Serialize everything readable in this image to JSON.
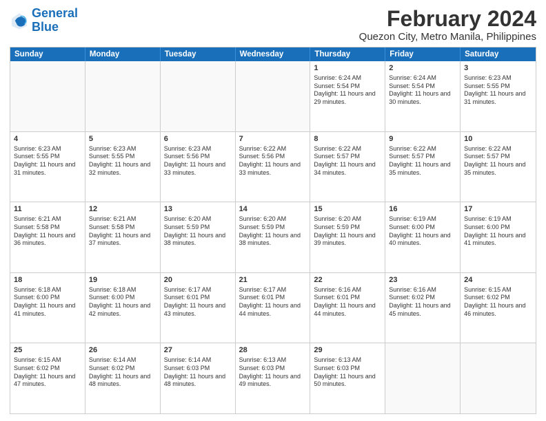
{
  "logo": {
    "line1": "General",
    "line2": "Blue"
  },
  "title": "February 2024",
  "subtitle": "Quezon City, Metro Manila, Philippines",
  "weekdays": [
    "Sunday",
    "Monday",
    "Tuesday",
    "Wednesday",
    "Thursday",
    "Friday",
    "Saturday"
  ],
  "weeks": [
    [
      {
        "day": "",
        "sunrise": "",
        "sunset": "",
        "daylight": ""
      },
      {
        "day": "",
        "sunrise": "",
        "sunset": "",
        "daylight": ""
      },
      {
        "day": "",
        "sunrise": "",
        "sunset": "",
        "daylight": ""
      },
      {
        "day": "",
        "sunrise": "",
        "sunset": "",
        "daylight": ""
      },
      {
        "day": "1",
        "sunrise": "Sunrise: 6:24 AM",
        "sunset": "Sunset: 5:54 PM",
        "daylight": "Daylight: 11 hours and 29 minutes."
      },
      {
        "day": "2",
        "sunrise": "Sunrise: 6:24 AM",
        "sunset": "Sunset: 5:54 PM",
        "daylight": "Daylight: 11 hours and 30 minutes."
      },
      {
        "day": "3",
        "sunrise": "Sunrise: 6:23 AM",
        "sunset": "Sunset: 5:55 PM",
        "daylight": "Daylight: 11 hours and 31 minutes."
      }
    ],
    [
      {
        "day": "4",
        "sunrise": "Sunrise: 6:23 AM",
        "sunset": "Sunset: 5:55 PM",
        "daylight": "Daylight: 11 hours and 31 minutes."
      },
      {
        "day": "5",
        "sunrise": "Sunrise: 6:23 AM",
        "sunset": "Sunset: 5:55 PM",
        "daylight": "Daylight: 11 hours and 32 minutes."
      },
      {
        "day": "6",
        "sunrise": "Sunrise: 6:23 AM",
        "sunset": "Sunset: 5:56 PM",
        "daylight": "Daylight: 11 hours and 33 minutes."
      },
      {
        "day": "7",
        "sunrise": "Sunrise: 6:22 AM",
        "sunset": "Sunset: 5:56 PM",
        "daylight": "Daylight: 11 hours and 33 minutes."
      },
      {
        "day": "8",
        "sunrise": "Sunrise: 6:22 AM",
        "sunset": "Sunset: 5:57 PM",
        "daylight": "Daylight: 11 hours and 34 minutes."
      },
      {
        "day": "9",
        "sunrise": "Sunrise: 6:22 AM",
        "sunset": "Sunset: 5:57 PM",
        "daylight": "Daylight: 11 hours and 35 minutes."
      },
      {
        "day": "10",
        "sunrise": "Sunrise: 6:22 AM",
        "sunset": "Sunset: 5:57 PM",
        "daylight": "Daylight: 11 hours and 35 minutes."
      }
    ],
    [
      {
        "day": "11",
        "sunrise": "Sunrise: 6:21 AM",
        "sunset": "Sunset: 5:58 PM",
        "daylight": "Daylight: 11 hours and 36 minutes."
      },
      {
        "day": "12",
        "sunrise": "Sunrise: 6:21 AM",
        "sunset": "Sunset: 5:58 PM",
        "daylight": "Daylight: 11 hours and 37 minutes."
      },
      {
        "day": "13",
        "sunrise": "Sunrise: 6:20 AM",
        "sunset": "Sunset: 5:59 PM",
        "daylight": "Daylight: 11 hours and 38 minutes."
      },
      {
        "day": "14",
        "sunrise": "Sunrise: 6:20 AM",
        "sunset": "Sunset: 5:59 PM",
        "daylight": "Daylight: 11 hours and 38 minutes."
      },
      {
        "day": "15",
        "sunrise": "Sunrise: 6:20 AM",
        "sunset": "Sunset: 5:59 PM",
        "daylight": "Daylight: 11 hours and 39 minutes."
      },
      {
        "day": "16",
        "sunrise": "Sunrise: 6:19 AM",
        "sunset": "Sunset: 6:00 PM",
        "daylight": "Daylight: 11 hours and 40 minutes."
      },
      {
        "day": "17",
        "sunrise": "Sunrise: 6:19 AM",
        "sunset": "Sunset: 6:00 PM",
        "daylight": "Daylight: 11 hours and 41 minutes."
      }
    ],
    [
      {
        "day": "18",
        "sunrise": "Sunrise: 6:18 AM",
        "sunset": "Sunset: 6:00 PM",
        "daylight": "Daylight: 11 hours and 41 minutes."
      },
      {
        "day": "19",
        "sunrise": "Sunrise: 6:18 AM",
        "sunset": "Sunset: 6:00 PM",
        "daylight": "Daylight: 11 hours and 42 minutes."
      },
      {
        "day": "20",
        "sunrise": "Sunrise: 6:17 AM",
        "sunset": "Sunset: 6:01 PM",
        "daylight": "Daylight: 11 hours and 43 minutes."
      },
      {
        "day": "21",
        "sunrise": "Sunrise: 6:17 AM",
        "sunset": "Sunset: 6:01 PM",
        "daylight": "Daylight: 11 hours and 44 minutes."
      },
      {
        "day": "22",
        "sunrise": "Sunrise: 6:16 AM",
        "sunset": "Sunset: 6:01 PM",
        "daylight": "Daylight: 11 hours and 44 minutes."
      },
      {
        "day": "23",
        "sunrise": "Sunrise: 6:16 AM",
        "sunset": "Sunset: 6:02 PM",
        "daylight": "Daylight: 11 hours and 45 minutes."
      },
      {
        "day": "24",
        "sunrise": "Sunrise: 6:15 AM",
        "sunset": "Sunset: 6:02 PM",
        "daylight": "Daylight: 11 hours and 46 minutes."
      }
    ],
    [
      {
        "day": "25",
        "sunrise": "Sunrise: 6:15 AM",
        "sunset": "Sunset: 6:02 PM",
        "daylight": "Daylight: 11 hours and 47 minutes."
      },
      {
        "day": "26",
        "sunrise": "Sunrise: 6:14 AM",
        "sunset": "Sunset: 6:02 PM",
        "daylight": "Daylight: 11 hours and 48 minutes."
      },
      {
        "day": "27",
        "sunrise": "Sunrise: 6:14 AM",
        "sunset": "Sunset: 6:03 PM",
        "daylight": "Daylight: 11 hours and 48 minutes."
      },
      {
        "day": "28",
        "sunrise": "Sunrise: 6:13 AM",
        "sunset": "Sunset: 6:03 PM",
        "daylight": "Daylight: 11 hours and 49 minutes."
      },
      {
        "day": "29",
        "sunrise": "Sunrise: 6:13 AM",
        "sunset": "Sunset: 6:03 PM",
        "daylight": "Daylight: 11 hours and 50 minutes."
      },
      {
        "day": "",
        "sunrise": "",
        "sunset": "",
        "daylight": ""
      },
      {
        "day": "",
        "sunrise": "",
        "sunset": "",
        "daylight": ""
      }
    ]
  ]
}
